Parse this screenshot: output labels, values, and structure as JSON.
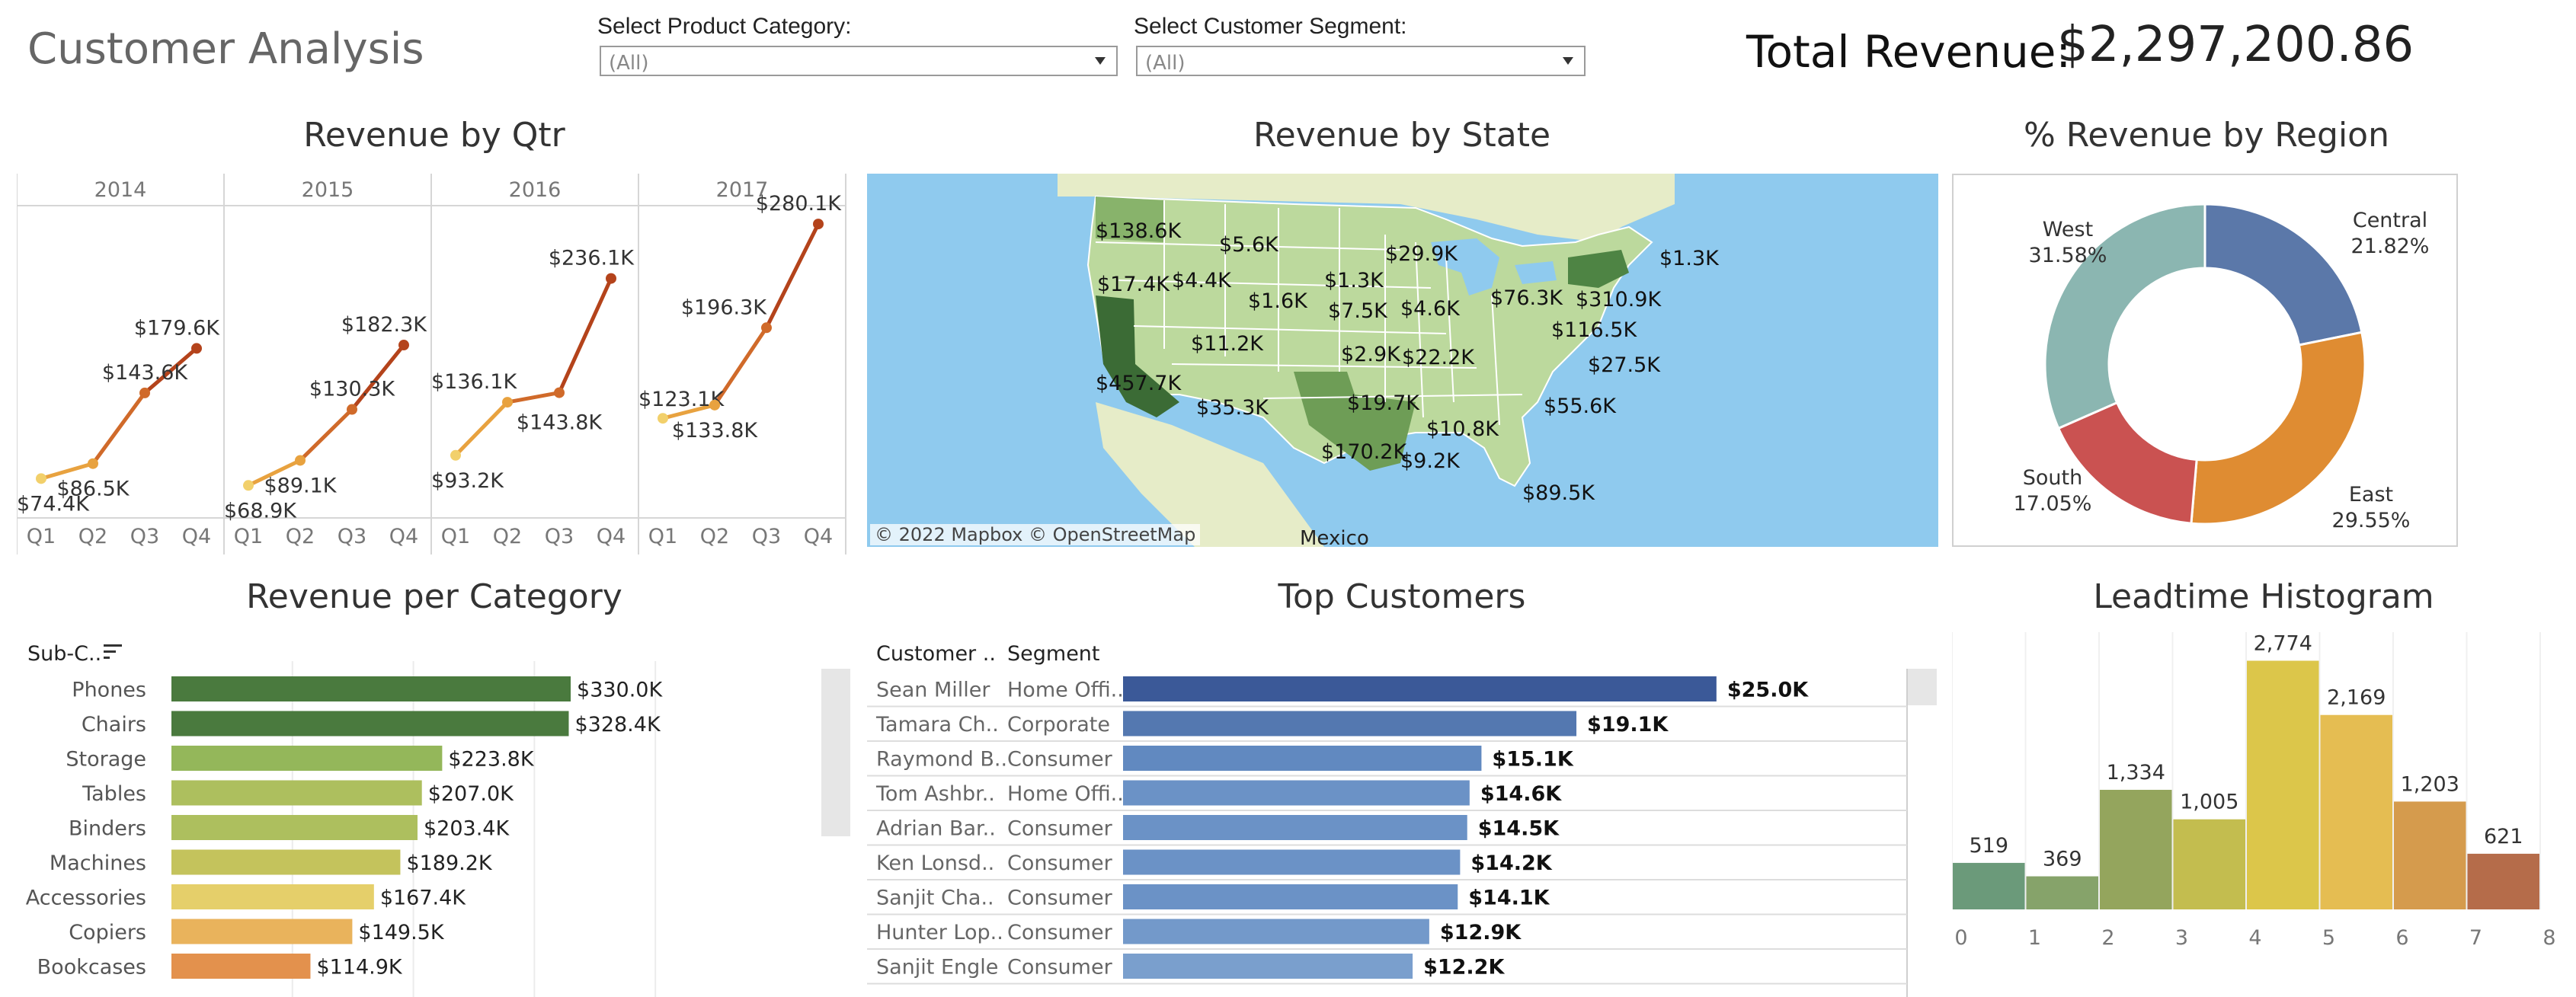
{
  "header": {
    "title": "Customer Analysis",
    "product_filter_label": "Select Product Category:",
    "product_filter_value": "(All)",
    "segment_filter_label": "Select Customer Segment:",
    "segment_filter_value": "(All)",
    "total_revenue_label": "Total Revenue:",
    "total_revenue_value": "$2,297,200.86"
  },
  "panels": {
    "qtr_title": "Revenue by Qtr",
    "state_title": "Revenue by State",
    "region_title": "% Revenue by Region",
    "category_title": "Revenue per Category",
    "customers_title": "Top Customers",
    "leadtime_title": "Leadtime Histogram"
  },
  "map": {
    "attribution": "© 2022 Mapbox  © OpenStreetMap",
    "mexico_label": "Mexico",
    "state_labels": [
      "$138.6K",
      "$5.6K",
      "$29.9K",
      "$1.3K",
      "$17.4K",
      "$4.4K",
      "$1.6K",
      "$1.3K",
      "$76.3K",
      "$310.9K",
      "$7.5K",
      "$4.6K",
      "$116.5K",
      "$11.2K",
      "$2.9K",
      "$22.2K",
      "$27.5K",
      "$457.7K",
      "$35.3K",
      "$19.7K",
      "$55.6K",
      "$10.8K",
      "$170.2K",
      "$9.2K",
      "$89.5K"
    ]
  },
  "category_table": {
    "header": "Sub-C..",
    "sort_icon": "sort-descending-icon"
  },
  "customers_table": {
    "col_customer": "Customer ..",
    "col_segment": "Segment"
  },
  "chart_data": [
    {
      "type": "line",
      "title": "Revenue by Qtr",
      "panels": [
        "2014",
        "2015",
        "2016",
        "2017"
      ],
      "categories": [
        "Q1",
        "Q2",
        "Q3",
        "Q4"
      ],
      "series": [
        {
          "panel": "2014",
          "values": [
            74.4,
            86.5,
            143.6,
            179.6
          ],
          "labels": [
            "$74.4K",
            "$86.5K",
            "$143.6K",
            "$179.6K"
          ]
        },
        {
          "panel": "2015",
          "values": [
            68.9,
            89.1,
            130.3,
            182.3
          ],
          "labels": [
            "$68.9K",
            "$89.1K",
            "$130.3K",
            "$182.3K"
          ]
        },
        {
          "panel": "2016",
          "values": [
            93.2,
            136.1,
            143.8,
            236.1
          ],
          "labels": [
            "$93.2K",
            "$136.1K",
            "$143.8K",
            "$236.1K"
          ]
        },
        {
          "panel": "2017",
          "values": [
            123.1,
            133.8,
            196.3,
            280.1
          ],
          "labels": [
            "$123.1K",
            "$133.8K",
            "$196.3K",
            "$280.1K"
          ]
        }
      ],
      "ylim": [
        50,
        290
      ],
      "colors": [
        "#f2d06b",
        "#e8a23f",
        "#d06a2a",
        "#b4431b"
      ]
    },
    {
      "type": "pie",
      "title": "% Revenue by Region",
      "categories": [
        "Central",
        "East",
        "South",
        "West"
      ],
      "values": [
        21.82,
        29.55,
        17.05,
        31.58
      ],
      "labels": [
        "21.82%",
        "29.55%",
        "17.05%",
        "31.58%"
      ],
      "colors": [
        "#5b78a9",
        "#df8c32",
        "#ca5251",
        "#8bb6b1"
      ]
    },
    {
      "type": "bar",
      "title": "Revenue per Category",
      "categories": [
        "Phones",
        "Chairs",
        "Storage",
        "Tables",
        "Binders",
        "Machines",
        "Accessories",
        "Copiers",
        "Bookcases"
      ],
      "values": [
        330.0,
        328.4,
        223.8,
        207.0,
        203.4,
        189.2,
        167.4,
        149.5,
        114.9
      ],
      "labels": [
        "$330.0K",
        "$328.4K",
        "$223.8K",
        "$207.0K",
        "$203.4K",
        "$189.2K",
        "$167.4K",
        "$149.5K",
        "$114.9K"
      ],
      "colors": [
        "#4a7a3e",
        "#4a7a3e",
        "#94b75a",
        "#adbf5e",
        "#adbf5e",
        "#c4c35c",
        "#e5cf6a",
        "#e9b35c",
        "#e3914d"
      ],
      "xlim": [
        0,
        400
      ]
    },
    {
      "type": "bar",
      "title": "Top Customers",
      "categories": [
        "Sean Miller",
        "Tamara Ch..",
        "Raymond B..",
        "Tom Ashbr..",
        "Adrian Bar..",
        "Ken Lonsd..",
        "Sanjit Cha..",
        "Hunter Lop..",
        "Sanjit Engle"
      ],
      "segments": [
        "Home Offi..",
        "Corporate",
        "Consumer",
        "Home Offi..",
        "Consumer",
        "Consumer",
        "Consumer",
        "Consumer",
        "Consumer"
      ],
      "values": [
        25.0,
        19.1,
        15.1,
        14.6,
        14.5,
        14.2,
        14.1,
        12.9,
        12.2
      ],
      "labels": [
        "$25.0K",
        "$19.1K",
        "$15.1K",
        "$14.6K",
        "$14.5K",
        "$14.2K",
        "$14.1K",
        "$12.9K",
        "$12.2K"
      ],
      "colors": [
        "#3b5998",
        "#5478b0",
        "#6189c0",
        "#6b92c6",
        "#6b92c6",
        "#6b92c6",
        "#6b92c6",
        "#7399ca",
        "#7a9fcd"
      ],
      "xlim": [
        0,
        26
      ]
    },
    {
      "type": "bar",
      "title": "Leadtime Histogram",
      "categories": [
        "0",
        "1",
        "2",
        "3",
        "4",
        "5",
        "6",
        "7"
      ],
      "x_ticks": [
        "0",
        "1",
        "2",
        "3",
        "4",
        "5",
        "6",
        "7",
        "8"
      ],
      "values": [
        519,
        369,
        1334,
        1005,
        2774,
        2169,
        1203,
        621
      ],
      "labels": [
        "519",
        "369",
        "1,334",
        "1,005",
        "2,774",
        "2,169",
        "1,203",
        "621"
      ],
      "colors": [
        "#6b9a7a",
        "#86a36a",
        "#94a55d",
        "#c3bd4f",
        "#dcc64a",
        "#e5bd52",
        "#d59b4d",
        "#b56c4a"
      ],
      "ylim": [
        0,
        3000
      ]
    }
  ]
}
